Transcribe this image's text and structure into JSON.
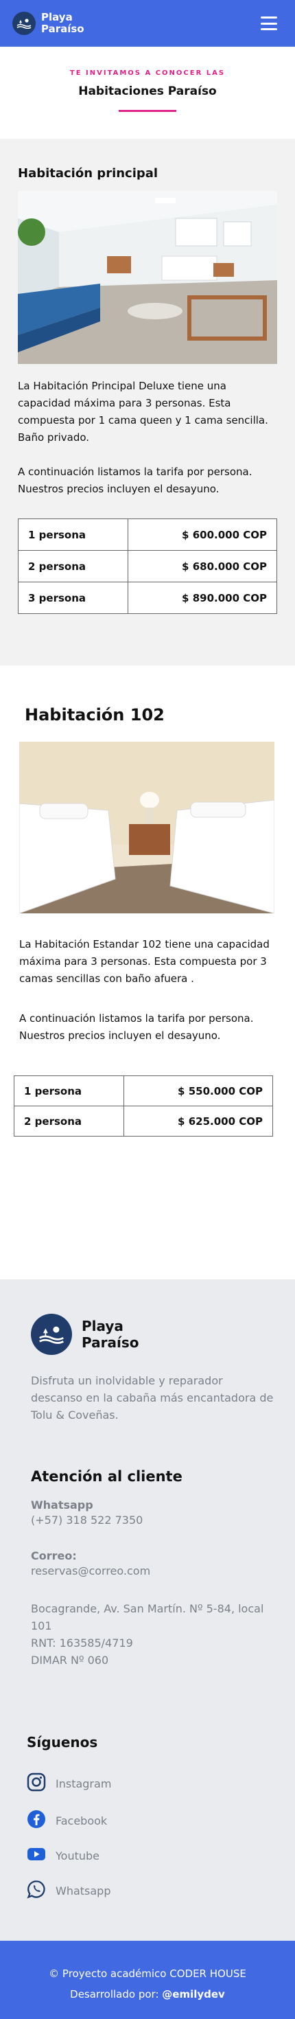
{
  "header": {
    "brand_line1": "Playa",
    "brand_line2": "Paraíso"
  },
  "intro": {
    "eyebrow": "TE INVITAMOS A CONOCER LAS",
    "title": "Habitaciones Paraíso"
  },
  "room1": {
    "title": "Habitación principal",
    "description": "La Habitación Principal Deluxe tiene una capacidad máxima para 3 personas. Esta compuesta por 1 cama queen y 1 cama sencilla. Baño privado.",
    "rates_note": "A continuación listamos la tarifa por persona. Nuestros precios incluyen el desayuno.",
    "rates": [
      {
        "people": "1 persona",
        "price": "$ 600.000 COP"
      },
      {
        "people": "2 persona",
        "price": "$ 680.000 COP"
      },
      {
        "people": "3 persona",
        "price": "$ 890.000 COP"
      }
    ]
  },
  "room2": {
    "title": "Habitación 102",
    "description": "La Habitación Estandar 102 tiene una capacidad máxima para 3 personas. Esta compuesta por 3 camas sencillas con baño afuera .",
    "rates_note": "A continuación listamos la tarifa por persona. Nuestros precios incluyen el desayuno.",
    "rates": [
      {
        "people": "1 persona",
        "price": "$ 550.000 COP"
      },
      {
        "people": "2 persona",
        "price": "$ 625.000 COP"
      }
    ]
  },
  "footer": {
    "brand_line1": "Playa",
    "brand_line2": "Paraíso",
    "about": "Disfruta un inolvidable y reparador descanso en la cabaña más encantadora de Tolu & Coveñas.",
    "contact_heading": "Atención al cliente",
    "whatsapp_label": "Whatsapp",
    "whatsapp_number": "(+57) 318 522 7350",
    "email_label": "Correo:",
    "email": "reservas@correo.com",
    "address": "Bocagrande, Av. San Martín. Nº 5-84, local 101",
    "rnt": "RNT: 163585/4719",
    "dimar": "DIMAR Nº 060",
    "social_heading": "Síguenos",
    "social": [
      {
        "label": "Instagram",
        "icon": "instagram-icon"
      },
      {
        "label": "Facebook",
        "icon": "facebook-icon"
      },
      {
        "label": "Youtube",
        "icon": "youtube-icon"
      },
      {
        "label": "Whatsapp",
        "icon": "whatsapp-icon"
      }
    ]
  },
  "copyright": {
    "line1": "© Proyecto académico CODER HOUSE",
    "line2_prefix": "Desarrollado por:",
    "author": "@emilydev"
  },
  "colors": {
    "primary": "#4169e1",
    "accent": "#e0218a",
    "logo_bg": "#1f3c6b",
    "footer_bg": "#e9ebef",
    "muted_text": "#7c8088"
  }
}
